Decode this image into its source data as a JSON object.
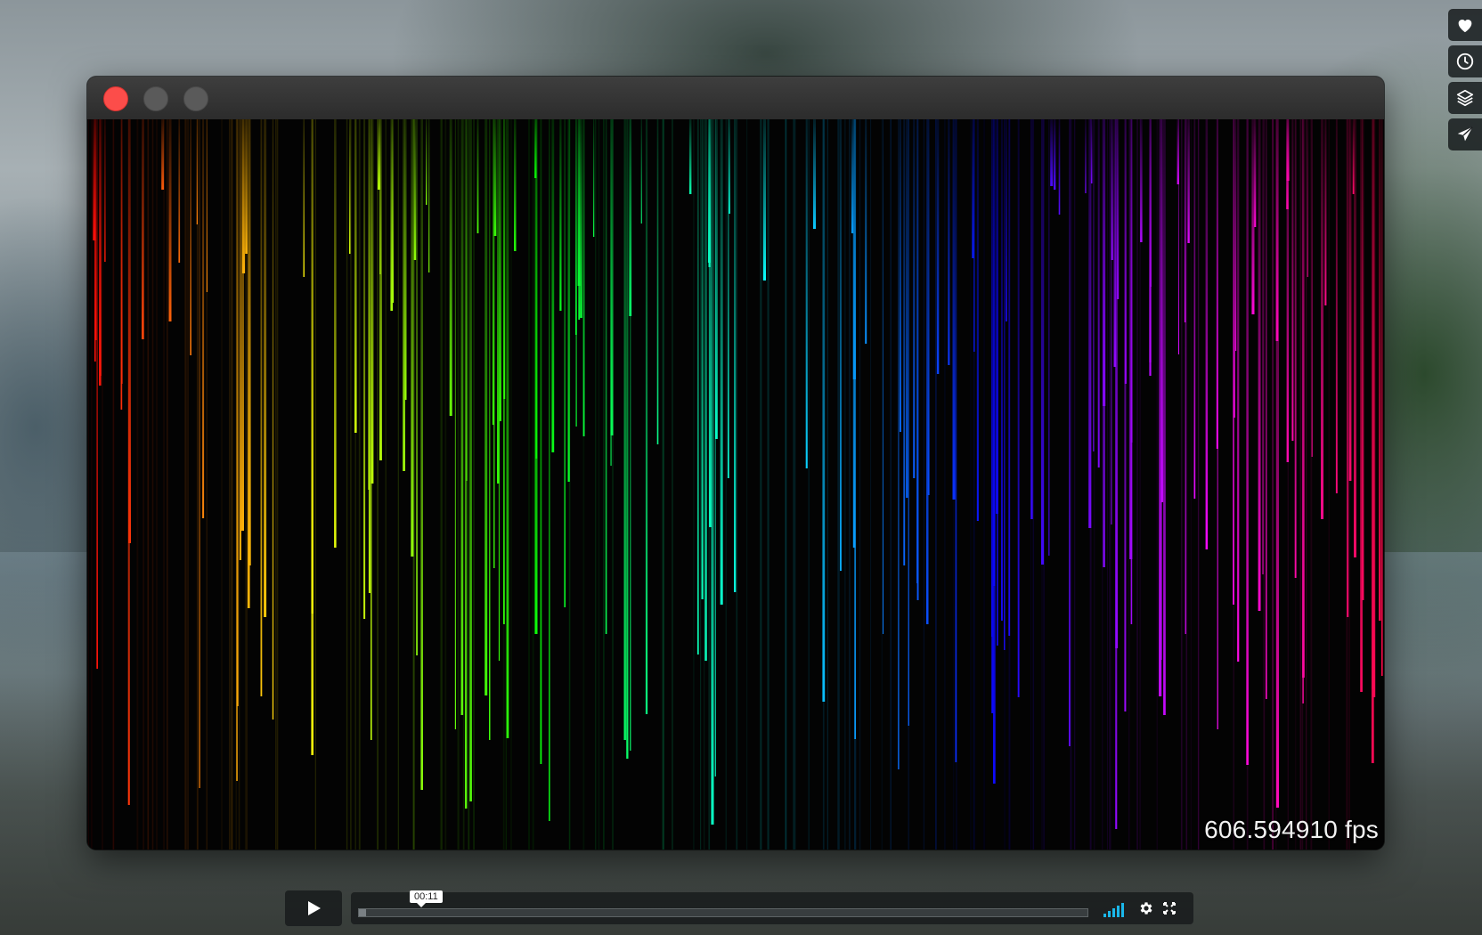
{
  "app": {
    "fps_text": "606.594910 fps"
  },
  "window_controls": {
    "close_color": "#fc4d4a",
    "inactive_color": "#5a5a5a"
  },
  "rain": {
    "palette": "rainbow hue sweep left-to-right, red to violet to red"
  },
  "side_toolbar": {
    "items": [
      {
        "icon": "heart-icon"
      },
      {
        "icon": "clock-icon"
      },
      {
        "icon": "layers-icon"
      },
      {
        "icon": "send-icon"
      }
    ]
  },
  "player": {
    "current_time": "00:11",
    "progress": 0.01,
    "volume_level": 1.0,
    "accent_color": "#1ab7ea"
  }
}
